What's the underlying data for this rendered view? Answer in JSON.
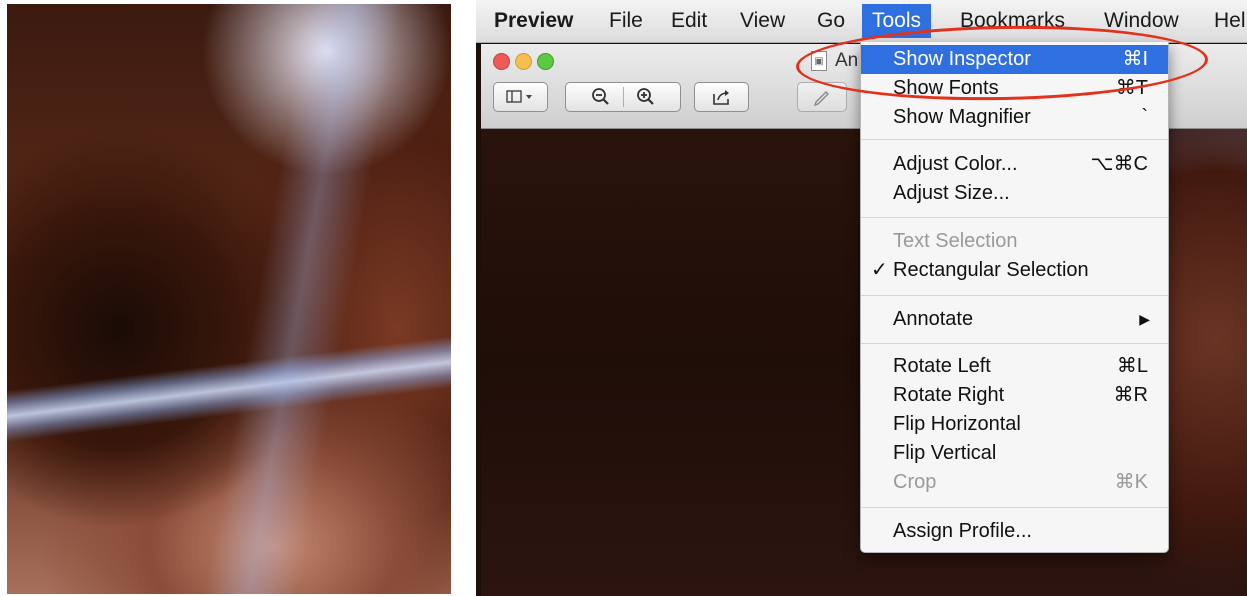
{
  "menubar": {
    "app": "Preview",
    "items": [
      "File",
      "Edit",
      "View",
      "Go",
      "Tools",
      "Bookmarks",
      "Window",
      "Hel"
    ],
    "active": "Tools"
  },
  "window": {
    "title_partial": "An",
    "doc_icon_glyph": "▣"
  },
  "toolbar": {
    "sidebar_icon": "sidebar-icon",
    "zoom_out_icon": "zoom-out-icon",
    "zoom_in_icon": "zoom-in-icon",
    "share_icon": "share-icon",
    "edit_icon": "pencil-icon"
  },
  "tools_menu": {
    "show_inspector": {
      "label": "Show Inspector",
      "shortcut": "⌘I"
    },
    "show_fonts": {
      "label": "Show Fonts",
      "shortcut": "⌘T"
    },
    "show_magnifier": {
      "label": "Show Magnifier",
      "shortcut": "`"
    },
    "adjust_color": {
      "label": "Adjust Color...",
      "shortcut": "⌥⌘C"
    },
    "adjust_size": {
      "label": "Adjust Size..."
    },
    "text_selection": {
      "label": "Text Selection"
    },
    "rectangular_selection": {
      "label": "Rectangular Selection",
      "check": "✓"
    },
    "annotate": {
      "label": "Annotate",
      "arrow": "▶"
    },
    "rotate_left": {
      "label": "Rotate Left",
      "shortcut": "⌘L"
    },
    "rotate_right": {
      "label": "Rotate Right",
      "shortcut": "⌘R"
    },
    "flip_horizontal": {
      "label": "Flip Horizontal"
    },
    "flip_vertical": {
      "label": "Flip Vertical"
    },
    "crop": {
      "label": "Crop",
      "shortcut": "⌘K"
    },
    "assign_profile": {
      "label": "Assign Profile..."
    }
  },
  "colors": {
    "highlight": "#2f6fe0",
    "annotation": "#e2311c"
  }
}
